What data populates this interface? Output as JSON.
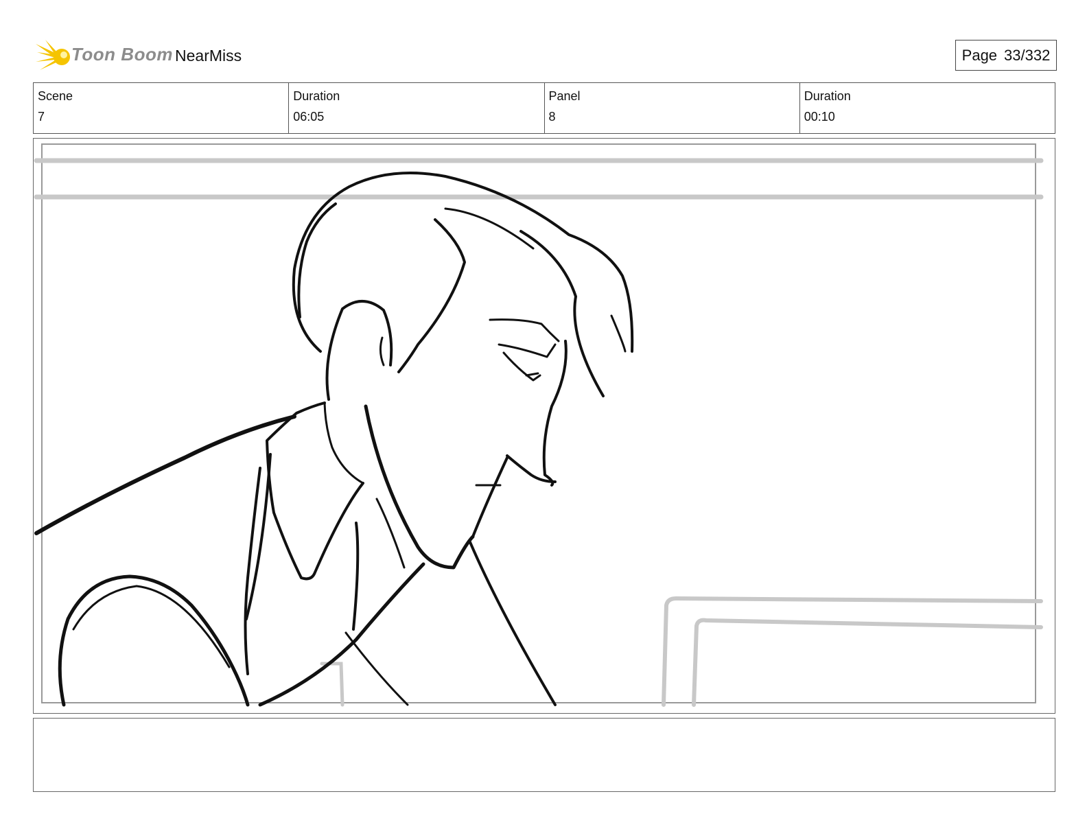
{
  "header": {
    "brand": "Toon Boom",
    "project": "NearMiss",
    "page_label": "Page",
    "page_value": "33/332"
  },
  "info": [
    {
      "label": "Scene",
      "value": "7"
    },
    {
      "label": "Duration",
      "value": "06:05"
    },
    {
      "label": "Panel",
      "value": "8"
    },
    {
      "label": "Duration",
      "value": "00:10"
    }
  ],
  "notes": {
    "text": ""
  },
  "colors": {
    "logo_yellow": "#f5c400",
    "sketch_line": "#111111",
    "guide_gray": "#c8c8c8"
  }
}
